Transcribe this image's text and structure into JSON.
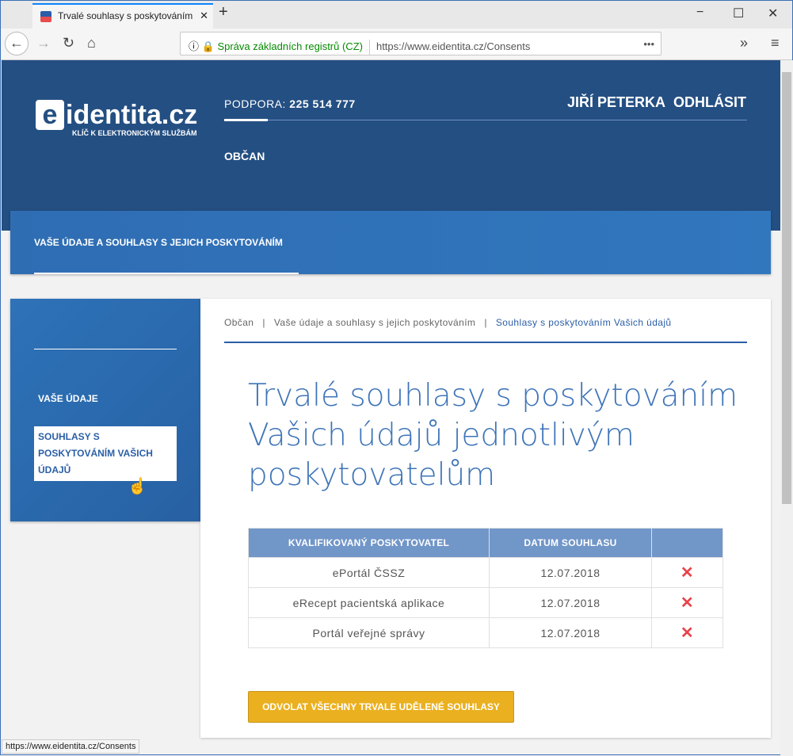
{
  "browser": {
    "tab_title": "Trvalé souhlasy s poskytováním",
    "new_tab": "+",
    "minimize": "−",
    "maximize": "☐",
    "close": "✕",
    "site_identity": "Správa základních registrů (CZ)",
    "url": "https://www.eidentita.cz/Consents",
    "more": "•••",
    "overflow": "»",
    "menu": "≡",
    "status_url": "https://www.eidentita.cz/Consents"
  },
  "header": {
    "logo_main": "identita.cz",
    "logo_e": "e",
    "logo_tagline": "KLÍČ K ELEKTRONICKÝM SLUŽBÁM",
    "support_label": "PODPORA:",
    "support_phone": "225 514 777",
    "user_name": "JIŘÍ PETERKA",
    "logout": "ODHLÁSIT",
    "nav_obcan": "OBČAN"
  },
  "banner": {
    "title": "VAŠE ÚDAJE A SOUHLASY S JEJICH POSKYTOVÁNÍM"
  },
  "sidebar": {
    "items": [
      {
        "label": "VAŠE ÚDAJE"
      },
      {
        "label": "SOUHLASY S POSKYTOVÁNÍM VAŠICH ÚDAJŮ"
      }
    ]
  },
  "breadcrumb": [
    "Občan",
    "Vaše údaje a souhlasy s jejich poskytováním",
    "Souhlasy s poskytováním Vašich údajů"
  ],
  "breadcrumb_sep": "|",
  "page_title": "Trvalé souhlasy s poskytováním Vašich údajů jednotlivým poskytovatelům",
  "table": {
    "headers": [
      "KVALIFIKOVANÝ POSKYTOVATEL",
      "DATUM SOUHLASU",
      ""
    ],
    "rows": [
      {
        "provider": "ePortál ČSSZ",
        "date": "12.07.2018"
      },
      {
        "provider": "eRecept pacientská aplikace",
        "date": "12.07.2018"
      },
      {
        "provider": "Portál veřejné správy",
        "date": "12.07.2018"
      }
    ],
    "remove_icon": "✕"
  },
  "revoke_button": "ODVOLAT VŠECHNY TRVALE UDĚLENÉ SOUHLASY"
}
